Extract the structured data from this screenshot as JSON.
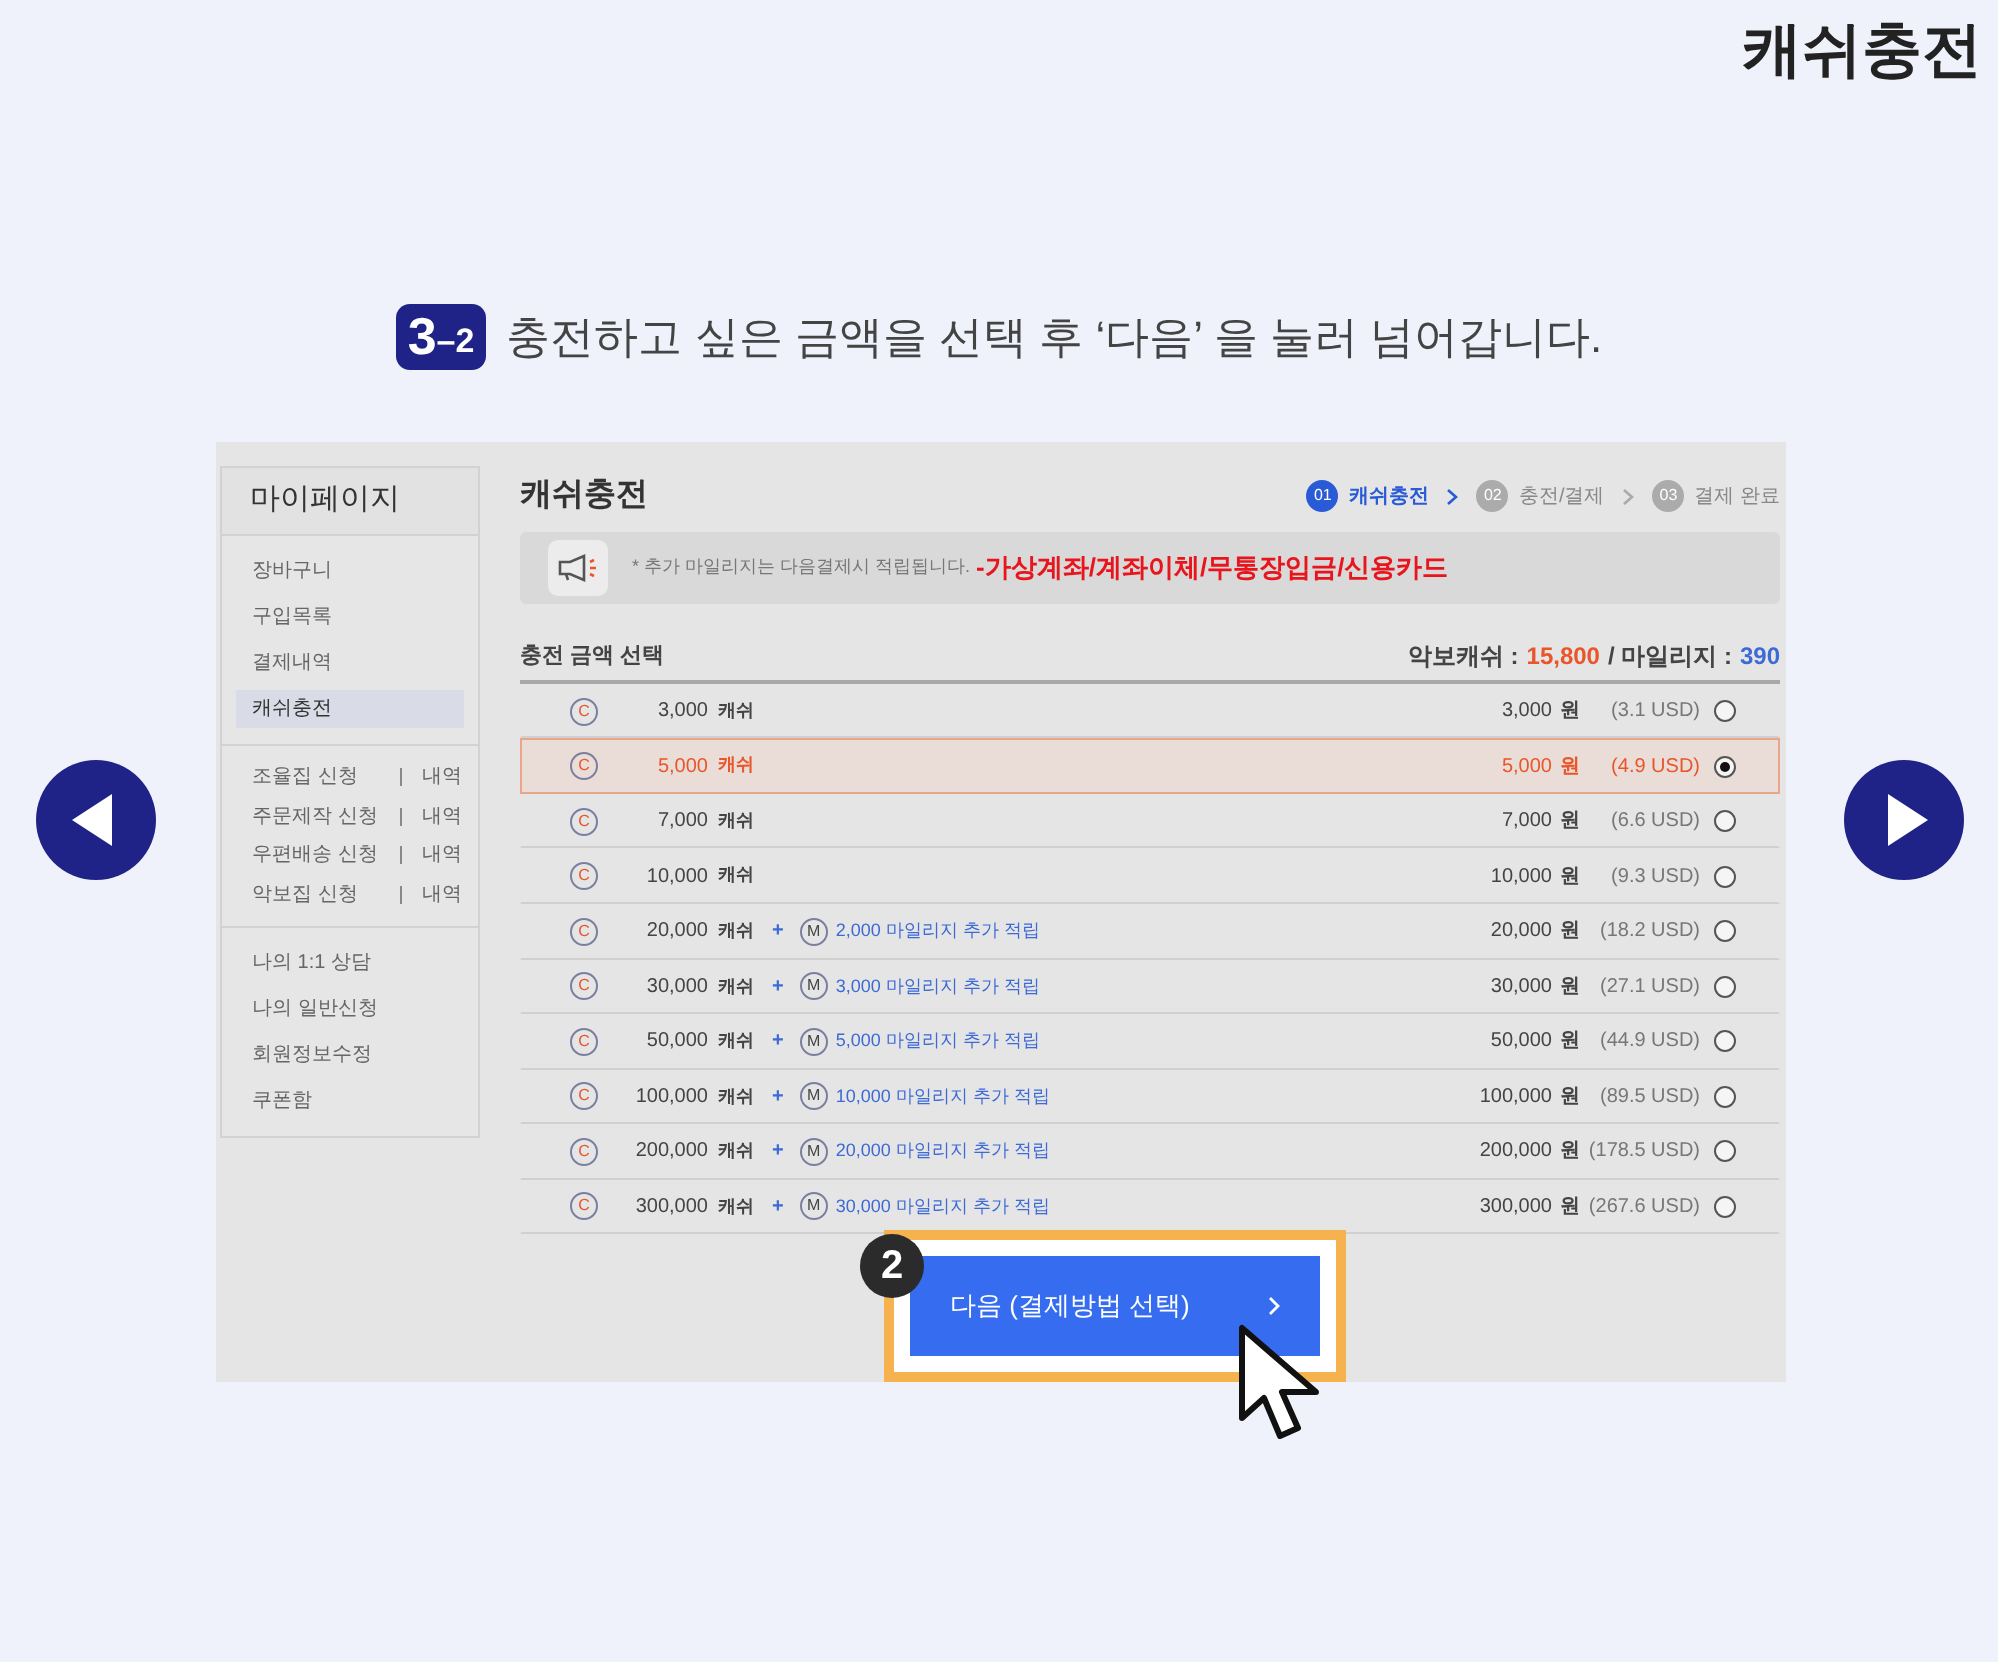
{
  "corner_title": "캐쉬충전",
  "instruction": {
    "step": "3",
    "substep": "–2",
    "text": "충전하고 싶은 금액을 선택 후 ‘다음’ 을 눌러 넘어갑니다."
  },
  "screen": {
    "sidebar": {
      "title": "마이페이지",
      "groups": [
        {
          "kind": "plain",
          "items": [
            {
              "label": "장바구니",
              "selected": false
            },
            {
              "label": "구입목록",
              "selected": false
            },
            {
              "label": "결제내역",
              "selected": false
            },
            {
              "label": "캐쉬충전",
              "selected": true
            }
          ]
        },
        {
          "kind": "request",
          "items": [
            {
              "label": "조율집 신청",
              "link": "내역"
            },
            {
              "label": "주문제작 신청",
              "link": "내역"
            },
            {
              "label": "우편배송 신청",
              "link": "내역"
            },
            {
              "label": "악보집 신청",
              "link": "내역"
            }
          ]
        },
        {
          "kind": "plain",
          "items": [
            {
              "label": "나의 1:1 상담",
              "selected": false
            },
            {
              "label": "나의 일반신청",
              "selected": false
            },
            {
              "label": "회원정보수정",
              "selected": false
            },
            {
              "label": "쿠폰함",
              "selected": false
            }
          ]
        }
      ]
    },
    "title": "캐쉬충전",
    "steps": [
      {
        "num": "01",
        "label": "캐쉬충전",
        "selected": true
      },
      {
        "num": "02",
        "label": "충전/결제",
        "selected": false
      },
      {
        "num": "03",
        "label": "결제 완료",
        "selected": false
      }
    ],
    "notice": {
      "mark": "*",
      "text": "추가 마일리지는 다음결제시 적립됩니다.",
      "highlight": "-가상계좌/계좌이체/무통장입금/신용카드"
    },
    "section_title": "충전 금액 선택",
    "balance": {
      "cash_label": "악보캐쉬 :",
      "cash": "15,800",
      "mileage_label": "/ 마일리지 :",
      "mileage": "390"
    },
    "rows": [
      {
        "cash_mark": "C",
        "cash": "3,000",
        "unit": "캐쉬",
        "price": "3,000",
        "currency": "원",
        "usd": "(3.1 USD)",
        "selected": false
      },
      {
        "cash_mark": "C",
        "cash": "5,000",
        "unit": "캐쉬",
        "price": "5,000",
        "currency": "원",
        "usd": "(4.9 USD)",
        "selected": true
      },
      {
        "cash_mark": "C",
        "cash": "7,000",
        "unit": "캐쉬",
        "price": "7,000",
        "currency": "원",
        "usd": "(6.6 USD)",
        "selected": false
      },
      {
        "cash_mark": "C",
        "cash": "10,000",
        "unit": "캐쉬",
        "price": "10,000",
        "currency": "원",
        "usd": "(9.3 USD)",
        "selected": false
      },
      {
        "cash_mark": "C",
        "cash": "20,000",
        "unit": "캐쉬",
        "plus": "+",
        "mileage_mark": "M",
        "bonus": "2,000 마일리지 추가 적립",
        "price": "20,000",
        "currency": "원",
        "usd": "(18.2 USD)",
        "selected": false
      },
      {
        "cash_mark": "C",
        "cash": "30,000",
        "unit": "캐쉬",
        "plus": "+",
        "mileage_mark": "M",
        "bonus": "3,000 마일리지 추가 적립",
        "price": "30,000",
        "currency": "원",
        "usd": "(27.1 USD)",
        "selected": false
      },
      {
        "cash_mark": "C",
        "cash": "50,000",
        "unit": "캐쉬",
        "plus": "+",
        "mileage_mark": "M",
        "bonus": "5,000 마일리지 추가 적립",
        "price": "50,000",
        "currency": "원",
        "usd": "(44.9 USD)",
        "selected": false
      },
      {
        "cash_mark": "C",
        "cash": "100,000",
        "unit": "캐쉬",
        "plus": "+",
        "mileage_mark": "M",
        "bonus": "10,000 마일리지 추가 적립",
        "price": "100,000",
        "currency": "원",
        "usd": "(89.5 USD)",
        "selected": false
      },
      {
        "cash_mark": "C",
        "cash": "200,000",
        "unit": "캐쉬",
        "plus": "+",
        "mileage_mark": "M",
        "bonus": "20,000 마일리지 추가 적립",
        "price": "200,000",
        "currency": "원",
        "usd": "(178.5 USD)",
        "selected": false
      },
      {
        "cash_mark": "C",
        "cash": "300,000",
        "unit": "캐쉬",
        "plus": "+",
        "mileage_mark": "M",
        "bonus": "30,000 마일리지 추가 적립",
        "price": "300,000",
        "currency": "원",
        "usd": "(267.6 USD)",
        "selected": false
      }
    ],
    "next_button": {
      "label": "다음 (결제방법 선택)",
      "badge": "2"
    }
  }
}
